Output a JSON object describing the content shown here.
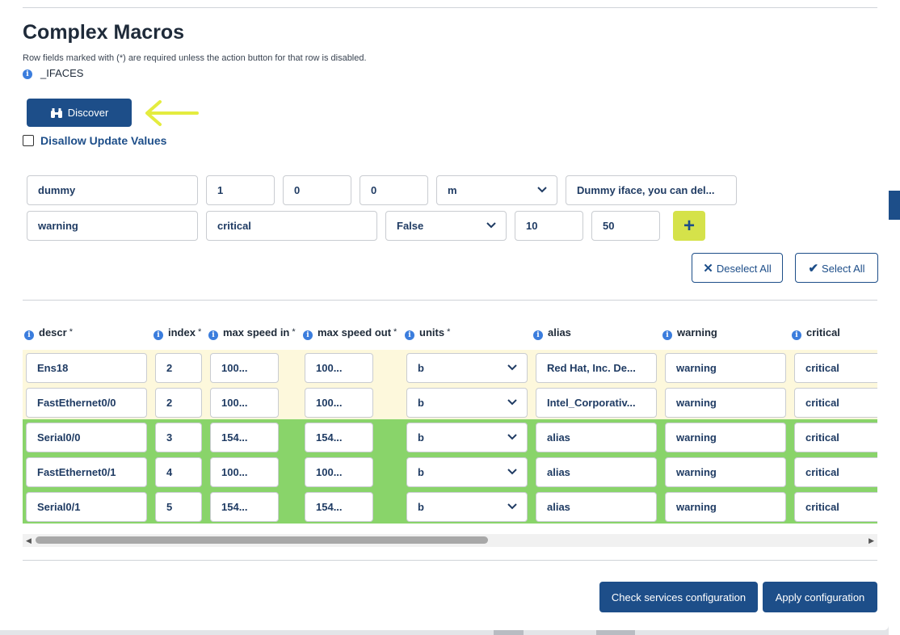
{
  "page": {
    "title": "Complex Macros",
    "hint": "Row fields marked with (*) are required unless the action button for that row is disabled.",
    "macro_name": "_IFACES"
  },
  "discover": {
    "label": "Discover",
    "icon": "binoculars-icon"
  },
  "options": {
    "disallow_update_label": "Disallow Update Values",
    "disallow_update_checked": false
  },
  "new_row": {
    "descr": "dummy",
    "index": "1",
    "max_speed_in": "0",
    "max_speed_out": "0",
    "units": "m",
    "alias": "Dummy iface, you can del...",
    "warning": "warning",
    "critical": "critical",
    "flag": "False",
    "threshold_1": "10",
    "threshold_2": "50",
    "add_label": "+"
  },
  "selection": {
    "deselect_all": "Deselect All",
    "select_all": "Select All"
  },
  "columns": [
    {
      "label": "descr",
      "required": "*"
    },
    {
      "label": "index",
      "required": "*"
    },
    {
      "label": "max speed in",
      "required": "*"
    },
    {
      "label": "max speed out",
      "required": "*"
    },
    {
      "label": "units",
      "required": "*"
    },
    {
      "label": "alias",
      "required": ""
    },
    {
      "label": "warning",
      "required": ""
    },
    {
      "label": "critical",
      "required": ""
    }
  ],
  "rows": [
    {
      "descr": "Ens18",
      "index": "2",
      "max_in": "100...",
      "max_out": "100...",
      "units": "b",
      "alias": "Red Hat, Inc. De...",
      "warning": "warning",
      "critical": "critical",
      "state": "existing"
    },
    {
      "descr": "FastEthernet0/0",
      "index": "2",
      "max_in": "100...",
      "max_out": "100...",
      "units": "b",
      "alias": "Intel_Corporativ...",
      "warning": "warning",
      "critical": "critical",
      "state": "existing"
    },
    {
      "descr": "Serial0/0",
      "index": "3",
      "max_in": "154...",
      "max_out": "154...",
      "units": "b",
      "alias": "alias",
      "warning": "warning",
      "critical": "critical",
      "state": "new"
    },
    {
      "descr": "FastEthernet0/1",
      "index": "4",
      "max_in": "100...",
      "max_out": "100...",
      "units": "b",
      "alias": "alias",
      "warning": "warning",
      "critical": "critical",
      "state": "new"
    },
    {
      "descr": "Serial0/1",
      "index": "5",
      "max_in": "154...",
      "max_out": "154...",
      "units": "b",
      "alias": "alias",
      "warning": "warning",
      "critical": "critical",
      "state": "new"
    }
  ],
  "footer": {
    "check_services": "Check services configuration",
    "apply": "Apply configuration"
  },
  "colors": {
    "primary": "#1d4e89",
    "existing_row": "#fdf8dc",
    "new_row": "#89d46a",
    "add_button": "#d5e24a",
    "annotation_arrow": "#e4ec3f"
  }
}
